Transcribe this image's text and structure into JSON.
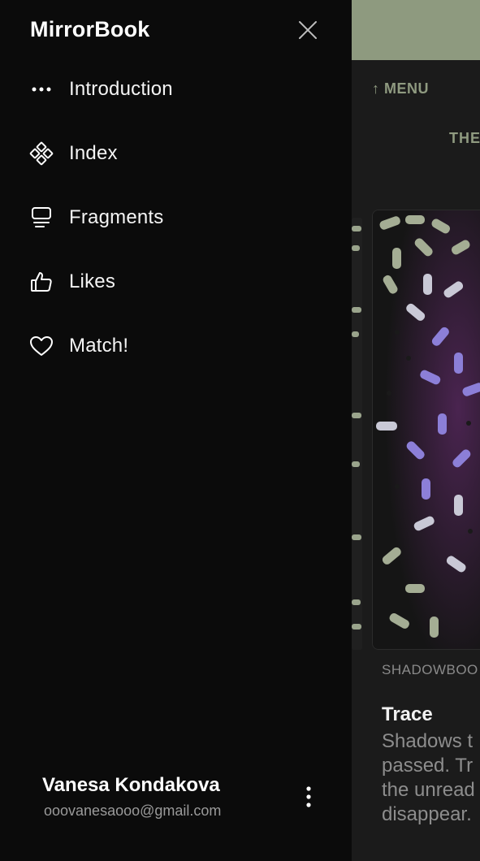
{
  "drawer": {
    "title": "MirrorBook",
    "close_icon": "close-icon",
    "items": [
      {
        "label": "Introduction",
        "icon": "more-horizontal-icon"
      },
      {
        "label": "Index",
        "icon": "index-grid-icon"
      },
      {
        "label": "Fragments",
        "icon": "fragments-icon"
      },
      {
        "label": "Likes",
        "icon": "thumbs-up-icon"
      },
      {
        "label": "Match!",
        "icon": "heart-icon"
      }
    ],
    "user": {
      "name": "Vanesa Kondakova",
      "email": "ooovanesaooo@gmail.com",
      "menu_icon": "more-vertical-icon"
    }
  },
  "background": {
    "menu_link": "↑ MENU",
    "section_partial": "THE",
    "card": {
      "category_partial": "SHADOWBOO",
      "title": "Trace",
      "desc_partial": "Shadows t\npassed. Tr\nthe unread\ndisappear."
    }
  },
  "colors": {
    "drawer_bg": "#0b0b0b",
    "topbar_accent": "#8e9a7f",
    "text_primary": "#ffffff",
    "text_secondary": "#9a9a9a"
  }
}
